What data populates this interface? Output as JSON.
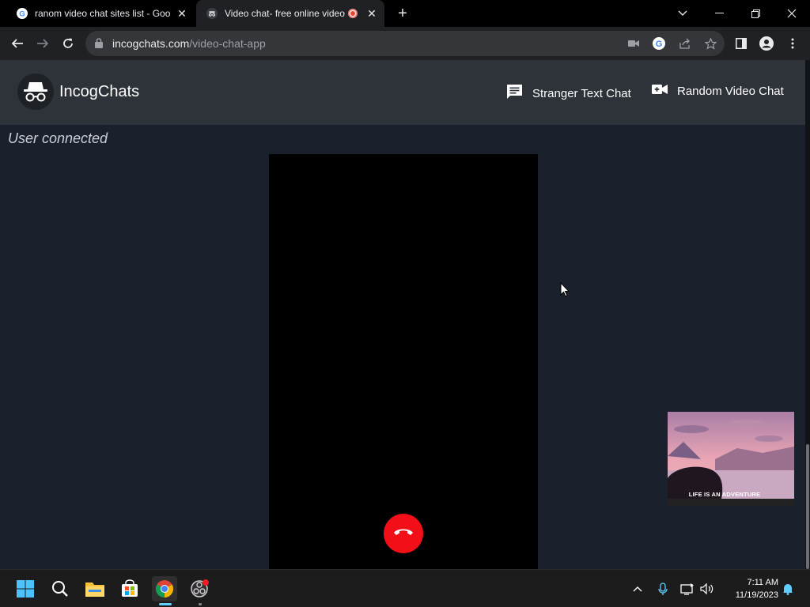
{
  "browser": {
    "tabs": [
      {
        "title": "ranom video chat sites list - Goo",
        "active": false
      },
      {
        "title": "Video chat- free online video",
        "active": true
      }
    ],
    "new_tab_label": "+",
    "url": {
      "host": "incogchats.com",
      "path": "/video-chat-app"
    }
  },
  "site": {
    "brand": "IncogChats",
    "nav": [
      {
        "label": "Stranger Text Chat",
        "icon": "chat-bubble-icon"
      },
      {
        "label": "Random Video Chat",
        "icon": "video-camera-icon"
      }
    ],
    "status": "User connected",
    "local_video_caption": "LIFE IS AN ADVENTURE"
  },
  "taskbar": {
    "apps": [
      "start-icon",
      "search-icon",
      "file-explorer-icon",
      "microsoft-store-icon",
      "chrome-icon",
      "obs-icon"
    ],
    "time": "7:11 AM",
    "date": "11/19/2023"
  },
  "colors": {
    "page_bg": "#1a202c",
    "header_bg": "#2d3339",
    "hangup": "#f20f18",
    "accent": "#60cdff"
  }
}
